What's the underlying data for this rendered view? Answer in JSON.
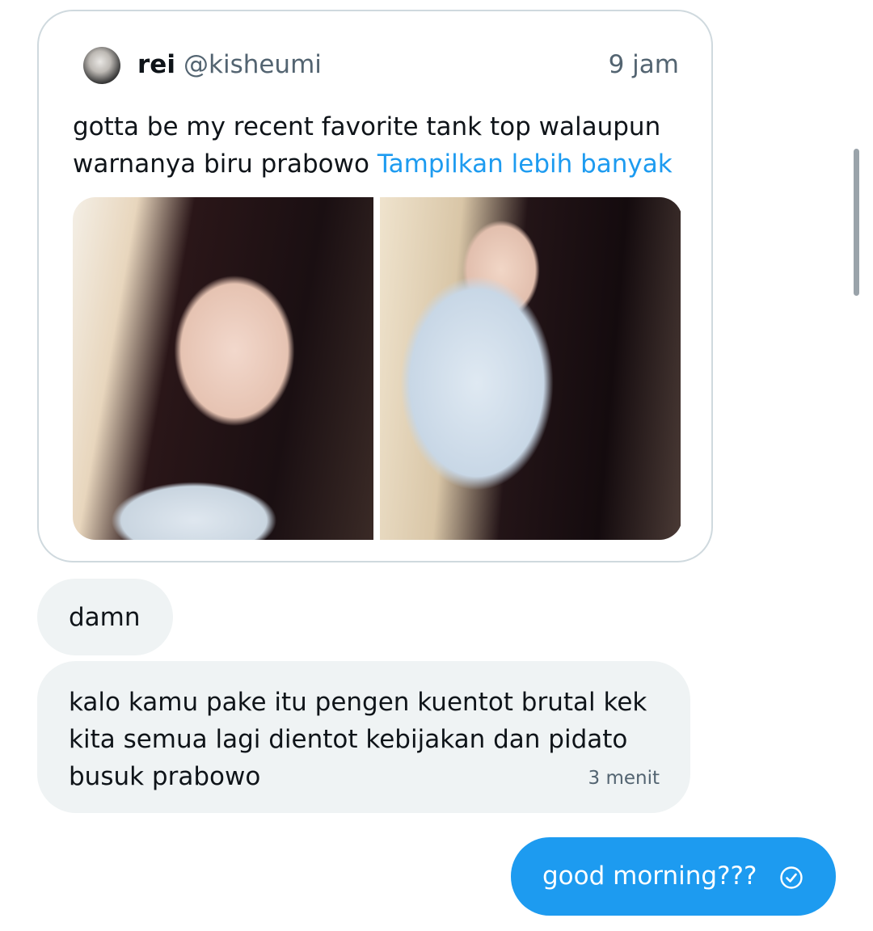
{
  "quote_tweet": {
    "name": "rei",
    "handle": "@kisheumi",
    "time": "9 jam",
    "text": "gotta be my recent favorite tank top walaupun warnanya biru prabowo",
    "show_more": "Tampilkan lebih banyak"
  },
  "messages": [
    {
      "direction": "received",
      "text": "damn"
    },
    {
      "direction": "received",
      "text": "kalo kamu pake itu pengen kuentot brutal kek kita semua lagi dientot kebijakan dan pidato busuk prabowo",
      "time": "3 menit"
    },
    {
      "direction": "sent",
      "text": "good morning???",
      "status_icon": "check-circle-icon"
    }
  ],
  "colors": {
    "accent": "#1d9bf0",
    "received_bubble": "#eff3f4",
    "secondary_text": "#536471",
    "border": "#cfd9de"
  }
}
